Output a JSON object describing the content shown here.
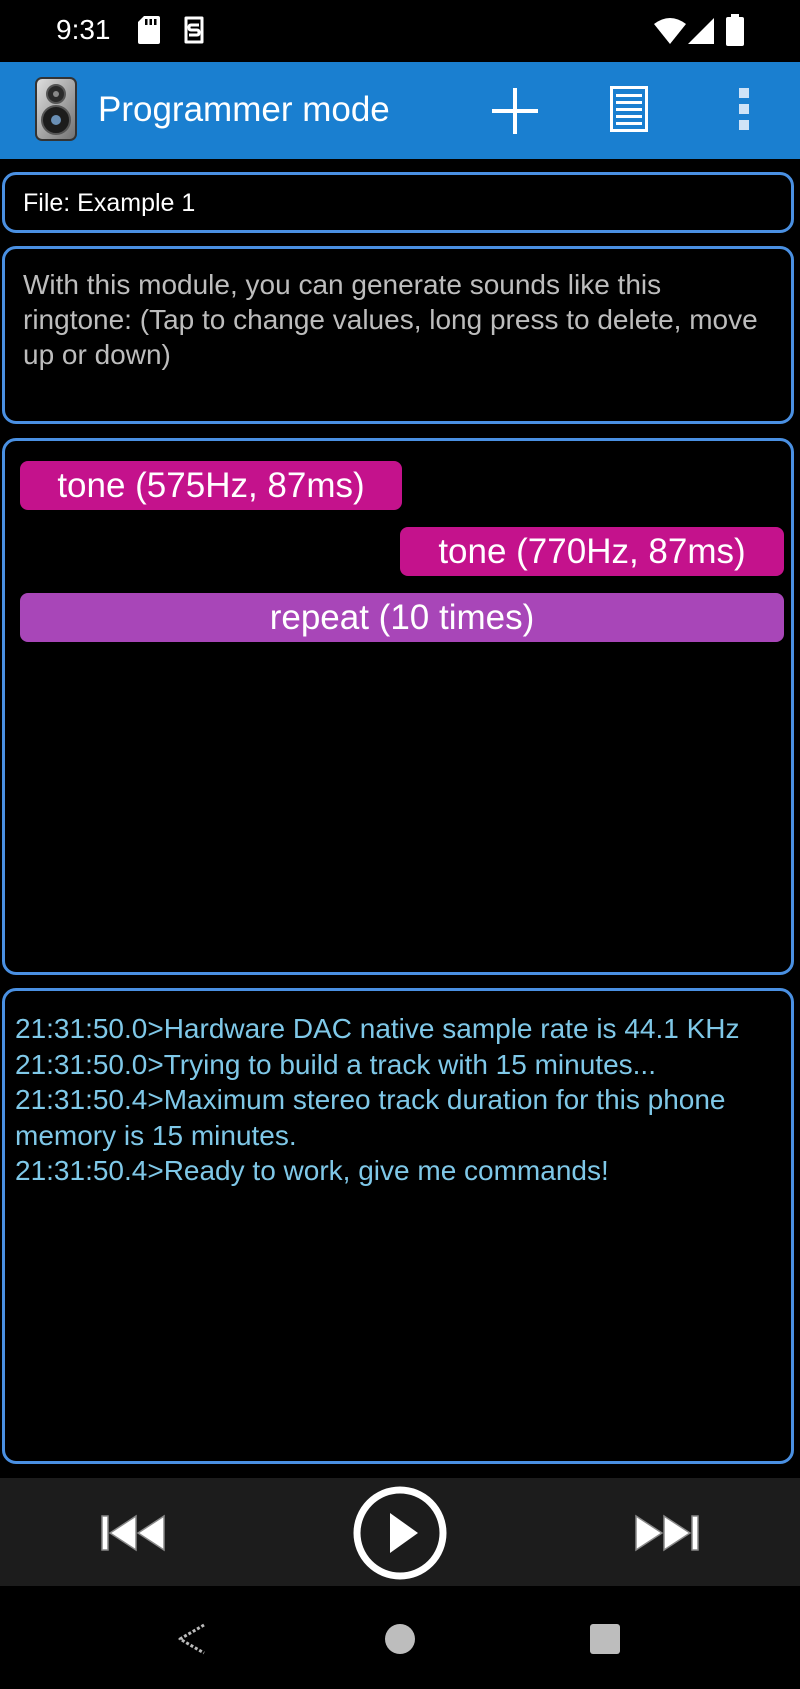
{
  "status_bar": {
    "time": "9:31",
    "icons": [
      "sd-card-icon",
      "sync-icon",
      "wifi-icon",
      "cellular-icon",
      "battery-icon"
    ]
  },
  "app_bar": {
    "title": "Programmer mode",
    "logo_icon": "speaker-icon",
    "actions": [
      "add-icon",
      "list-icon",
      "more-vertical-icon"
    ],
    "color": "#1a7fd0"
  },
  "file": {
    "label": "File: Example 1"
  },
  "description": {
    "text": "With this module, you can generate sounds like this ringtone: (Tap to change values, long press to delete, move up or down)"
  },
  "commands": [
    {
      "kind": "tone",
      "label": "tone (575Hz, 87ms)",
      "color": "#c4128c"
    },
    {
      "kind": "tone",
      "label": "tone (770Hz, 87ms)",
      "color": "#c4128c"
    },
    {
      "kind": "repeat",
      "label": "repeat (10 times)",
      "color": "#a846b8"
    }
  ],
  "log": {
    "lines": [
      "21:31:50.0>Hardware DAC native sample rate is 44.1 KHz",
      "21:31:50.0>Trying to build a track with 15 minutes...",
      "21:31:50.4>Maximum stereo track duration for this phone memory is 15 minutes.",
      "21:31:50.4>Ready to work, give me commands!"
    ],
    "color": "#7fc8e8"
  },
  "media_controls": {
    "icons": [
      "skip-previous-icon",
      "play-icon",
      "skip-next-icon"
    ]
  },
  "nav_bar": {
    "icons": [
      "back-icon",
      "home-icon",
      "recents-icon"
    ]
  },
  "colors": {
    "panel_border": "#4a90e2",
    "background": "#000000"
  }
}
